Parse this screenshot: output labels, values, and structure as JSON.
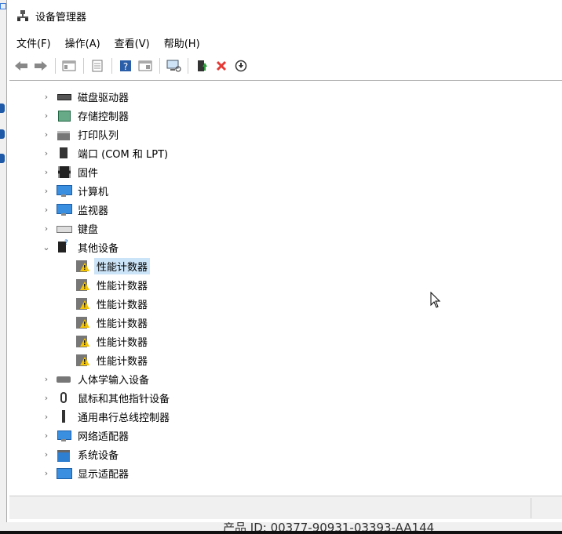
{
  "window": {
    "title": "设备管理器"
  },
  "menubar": {
    "items": [
      "文件(F)",
      "操作(A)",
      "查看(V)",
      "帮助(H)"
    ]
  },
  "tree": {
    "items": [
      {
        "label": "磁盘驱动器",
        "expanded": false,
        "icon": "disk-drive-icon"
      },
      {
        "label": "存储控制器",
        "expanded": false,
        "icon": "storage-controller-icon"
      },
      {
        "label": "打印队列",
        "expanded": false,
        "icon": "printer-icon"
      },
      {
        "label": "端口 (COM 和 LPT)",
        "expanded": false,
        "icon": "port-icon"
      },
      {
        "label": "固件",
        "expanded": false,
        "icon": "firmware-icon"
      },
      {
        "label": "计算机",
        "expanded": false,
        "icon": "computer-icon"
      },
      {
        "label": "监视器",
        "expanded": false,
        "icon": "monitor-icon"
      },
      {
        "label": "键盘",
        "expanded": false,
        "icon": "keyboard-icon"
      },
      {
        "label": "其他设备",
        "expanded": true,
        "icon": "other-devices-icon",
        "children": [
          {
            "label": "性能计数器",
            "selected": true,
            "icon": "warning-device-icon"
          },
          {
            "label": "性能计数器",
            "icon": "warning-device-icon"
          },
          {
            "label": "性能计数器",
            "icon": "warning-device-icon"
          },
          {
            "label": "性能计数器",
            "icon": "warning-device-icon"
          },
          {
            "label": "性能计数器",
            "icon": "warning-device-icon"
          },
          {
            "label": "性能计数器",
            "icon": "warning-device-icon"
          }
        ]
      },
      {
        "label": "人体学输入设备",
        "expanded": false,
        "icon": "hid-icon"
      },
      {
        "label": "鼠标和其他指针设备",
        "expanded": false,
        "icon": "mouse-icon"
      },
      {
        "label": "通用串行总线控制器",
        "expanded": false,
        "icon": "usb-icon"
      },
      {
        "label": "网络适配器",
        "expanded": false,
        "icon": "network-adapter-icon"
      },
      {
        "label": "系统设备",
        "expanded": false,
        "icon": "system-devices-icon"
      },
      {
        "label": "显示适配器",
        "expanded": false,
        "icon": "display-adapter-icon"
      }
    ]
  },
  "background": {
    "product_id": "产品 ID: 00377-90931-03393-AA144"
  },
  "colors": {
    "selection": "#cce4f7",
    "delete": "#e53935",
    "help": "#2b5ea8"
  }
}
